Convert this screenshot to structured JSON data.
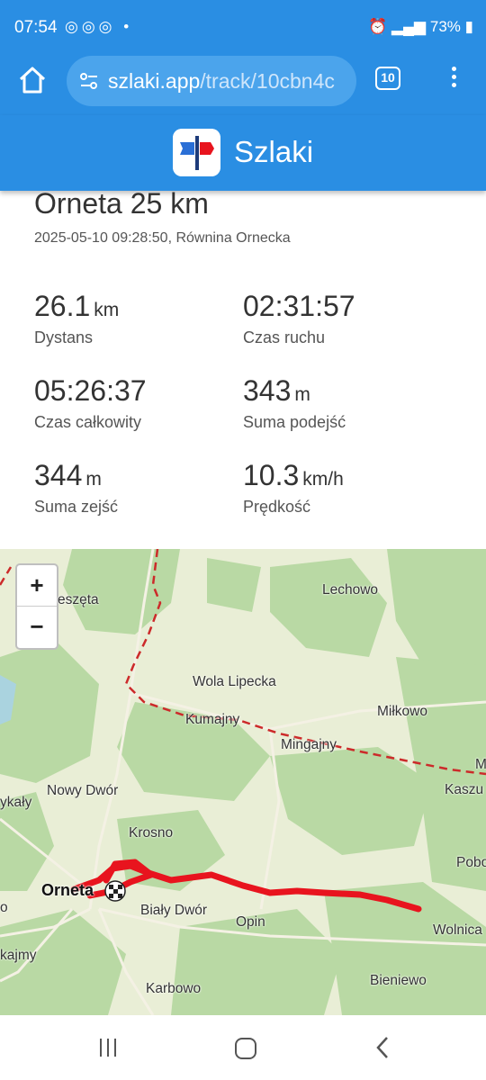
{
  "status_bar": {
    "time": "07:54",
    "battery": "73%"
  },
  "browser": {
    "url_host": "szlaki.app",
    "url_path": "/track/10cbn4c",
    "tab_count": "10"
  },
  "app": {
    "brand": "Szlaki"
  },
  "track": {
    "title": "Orneta 25 km",
    "subtitle": "2025-05-10 09:28:50, Równina Ornecka"
  },
  "stats": {
    "distance": {
      "value": "26.1",
      "unit": "km",
      "label": "Dystans"
    },
    "moving_time": {
      "value": "02:31:57",
      "unit": "",
      "label": "Czas ruchu"
    },
    "total_time": {
      "value": "05:26:37",
      "unit": "",
      "label": "Czas całkowity"
    },
    "ascent": {
      "value": "343",
      "unit": "m",
      "label": "Suma podejść"
    },
    "descent": {
      "value": "344",
      "unit": "m",
      "label": "Suma zejść"
    },
    "speed": {
      "value": "10.3",
      "unit": "km/h",
      "label": "Prędkość"
    }
  },
  "map": {
    "zoom_in": "+",
    "zoom_out": "−",
    "places": {
      "eszeta": "eszęta",
      "lechowo": "Lechowo",
      "wola_lipecka": "Wola Lipecka",
      "kumajny": "Kumajny",
      "milkowo": "Miłkowo",
      "mingajny": "Mingajny",
      "m": "M",
      "kszkaly": "ykały",
      "nowy_dwor": "Nowy Dwór",
      "kaszu": "Kaszu",
      "krosno": "Krosno",
      "pobo": "Pobo",
      "orneta": "Orneta",
      "bialy_dwor": "Biały Dwór",
      "opin": "Opin",
      "wolnica": "Wolnica",
      "o": "o",
      "kajmy": "kajmy",
      "karbowo": "Karbowo",
      "bieniewo": "Bieniewo"
    },
    "colors": {
      "track": "#e8141e",
      "forest": "#b9d9a4",
      "land": "#e9eed6"
    }
  }
}
